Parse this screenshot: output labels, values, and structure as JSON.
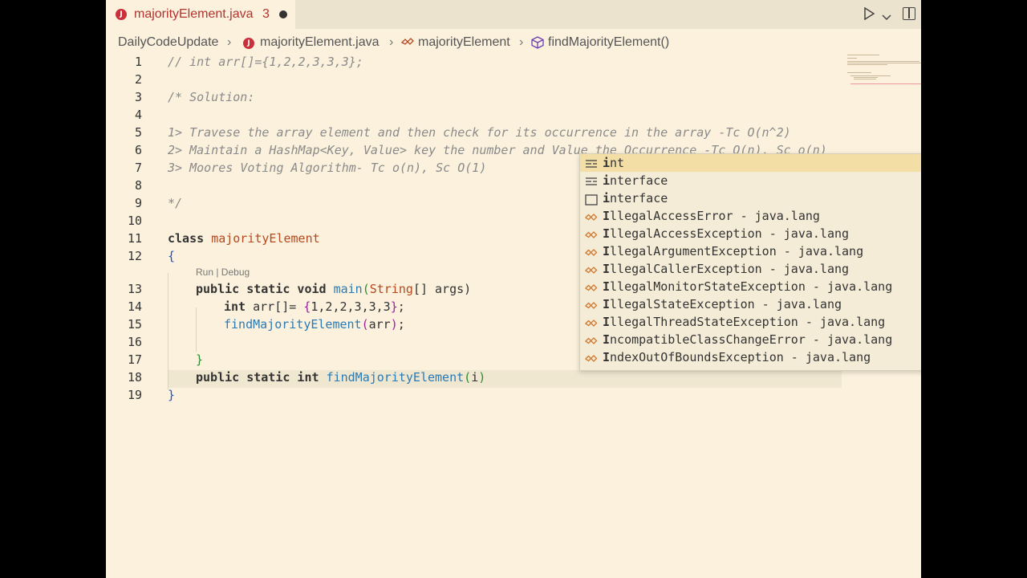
{
  "tab": {
    "filename": "majorityElement.java",
    "problems": "3",
    "java_badge": "J"
  },
  "breadcrumb": {
    "folder": "DailyCodeUpdate",
    "file": "majorityElement.java",
    "class": "majorityElement",
    "method": "findMajorityElement()"
  },
  "codelens": "Run | Debug",
  "lines": {
    "l1": "// int arr[]={1,2,2,3,3,3};",
    "l3": "/* Solution:",
    "l5": "1> Travese the array element and then check for its occurrence in the array -Tc O(n^2)",
    "l6": "2> Maintain a HashMap<Key, Value> key the number and Value the Occurrence -Tc O(n), Sc o(n)",
    "l7": "3> Moores Voting Algorithm- Tc o(n), Sc O(1)",
    "l9": "*/",
    "l11_kw": "class",
    "l11_cls": "majorityElement",
    "l12": "{",
    "l13_kw": "public static void",
    "l13_fn": "main",
    "l13_open": "(",
    "l13_type": "String",
    "l13_rest": "[] args)",
    "l14_kw": "int",
    "l14_var": " arr[]= ",
    "l14_b1": "{",
    "l14_vals": "1,2,2,3,3,3",
    "l14_b2": "}",
    "l14_end": ";",
    "l15_fn": "findMajorityElement",
    "l15_open": "(",
    "l15_arg": "arr",
    "l15_close": ")",
    "l15_end": ";",
    "l17": "}",
    "l18_kw": "public static int",
    "l18_fn": "findMajorityElement",
    "l18_open": "(",
    "l18_typed": "i",
    "l18_close": ")",
    "l19": "}"
  },
  "line_numbers": [
    "1",
    "2",
    "3",
    "4",
    "5",
    "6",
    "7",
    "8",
    "9",
    "10",
    "11",
    "12",
    "13",
    "14",
    "15",
    "16",
    "17",
    "18",
    "19"
  ],
  "suggestions": [
    {
      "match": "i",
      "rest": "nt",
      "detail": "",
      "icon": "keyword-icon"
    },
    {
      "match": "i",
      "rest": "nterface",
      "detail": "",
      "icon": "keyword-icon"
    },
    {
      "match": "i",
      "rest": "nterface",
      "detail": "",
      "icon": "snippet-icon"
    },
    {
      "match": "I",
      "rest": "llegalAccessError",
      "detail": " - java.lang",
      "icon": "class-icon"
    },
    {
      "match": "I",
      "rest": "llegalAccessException",
      "detail": " - java.lang",
      "icon": "class-icon"
    },
    {
      "match": "I",
      "rest": "llegalArgumentException",
      "detail": " - java.lang",
      "icon": "class-icon"
    },
    {
      "match": "I",
      "rest": "llegalCallerException",
      "detail": " - java.lang",
      "icon": "class-icon"
    },
    {
      "match": "I",
      "rest": "llegalMonitorStateException",
      "detail": " - java.lang",
      "icon": "class-icon"
    },
    {
      "match": "I",
      "rest": "llegalStateException",
      "detail": " - java.lang",
      "icon": "class-icon"
    },
    {
      "match": "I",
      "rest": "llegalThreadStateException",
      "detail": " - java.lang",
      "icon": "class-icon"
    },
    {
      "match": "I",
      "rest": "ncompatibleClassChangeError",
      "detail": " - java.lang",
      "icon": "class-icon"
    },
    {
      "match": "I",
      "rest": "ndexOutOfBoundsException",
      "detail": " - java.lang",
      "icon": "class-icon"
    }
  ],
  "colors": {
    "editor_bg": "#fbf1dd",
    "selection": "#f3dfa6",
    "error_tab": "#b3322f"
  }
}
